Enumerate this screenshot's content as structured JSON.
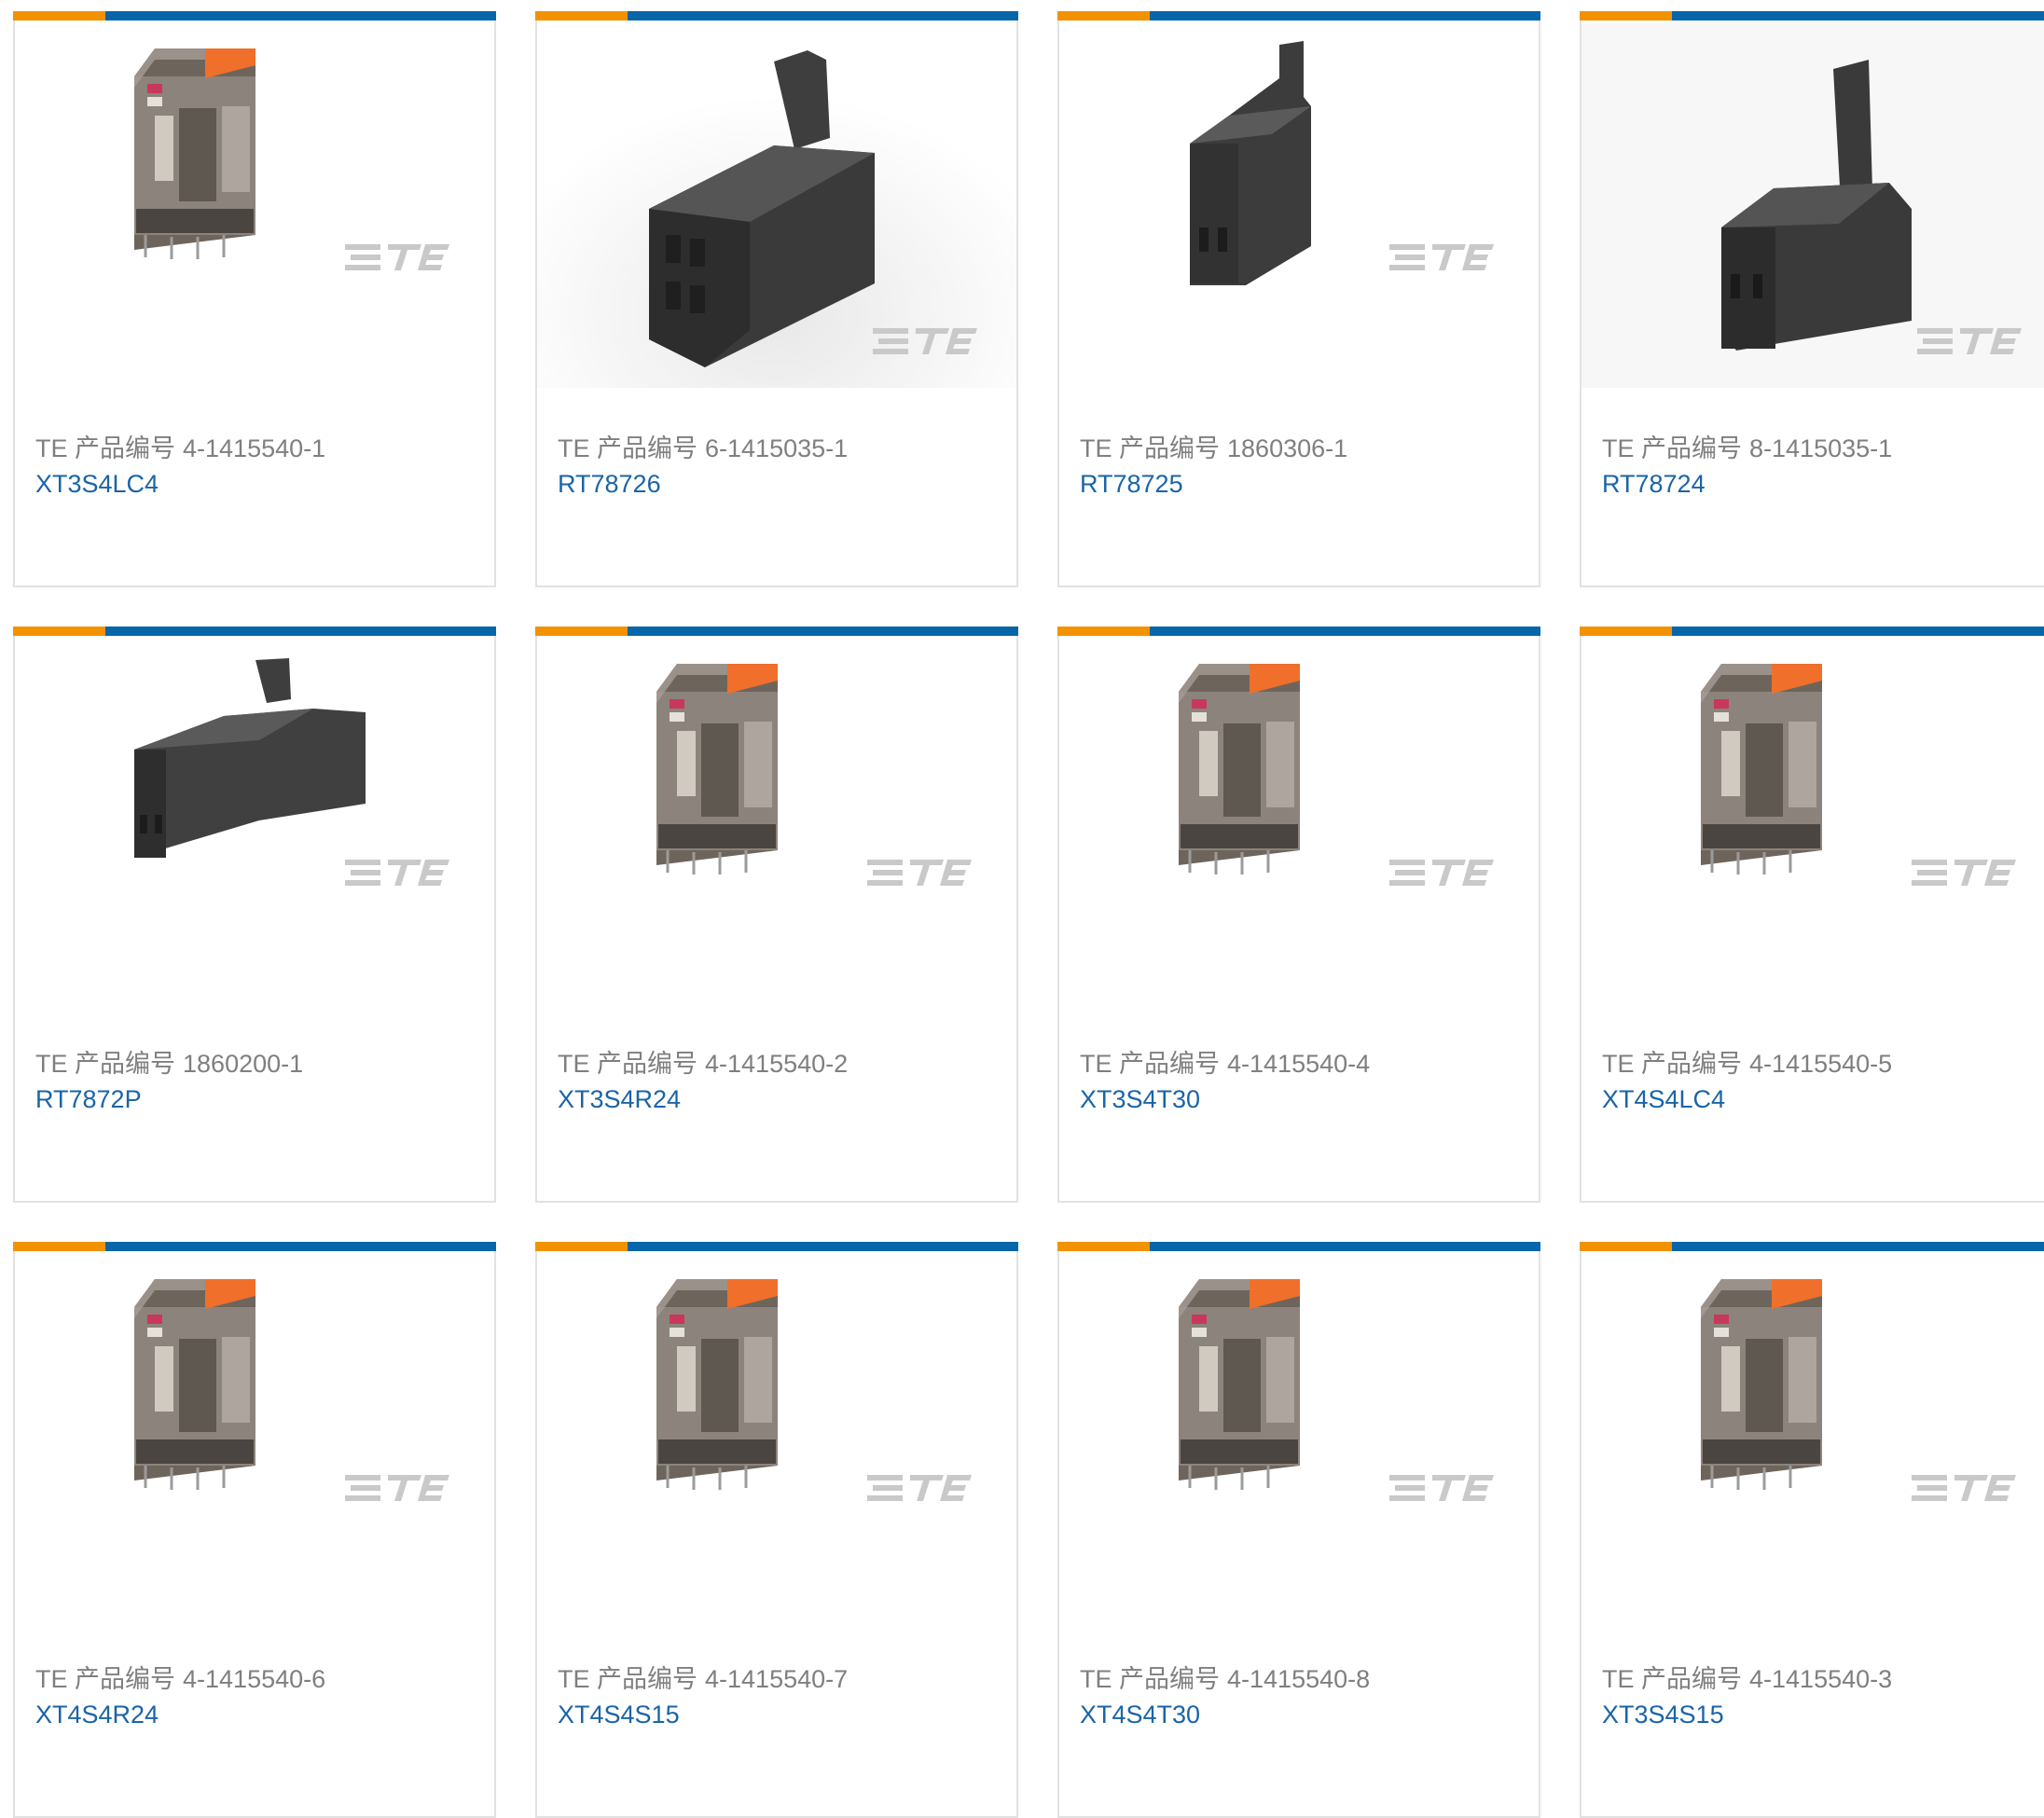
{
  "colors": {
    "accent_orange": "#f39200",
    "accent_blue": "#0765a9",
    "link": "#1a64a8",
    "label": "#7f7f7f"
  },
  "products": [
    {
      "label": "TE 产品编号",
      "part_number": "4-1415540-1",
      "model": "XT3S4LC4",
      "image": "relay-icon"
    },
    {
      "label": "TE 产品编号",
      "part_number": "6-1415035-1",
      "model": "RT78726",
      "image": "socket-icon"
    },
    {
      "label": "TE 产品编号",
      "part_number": "1860306-1",
      "model": "RT78725",
      "image": "socket-icon"
    },
    {
      "label": "TE 产品编号",
      "part_number": "8-1415035-1",
      "model": "RT78724",
      "image": "socket-icon"
    },
    {
      "label": "TE 产品编号",
      "part_number": "1860200-1",
      "model": "RT7872P",
      "image": "socket-icon"
    },
    {
      "label": "TE 产品编号",
      "part_number": "4-1415540-2",
      "model": "XT3S4R24",
      "image": "relay-icon"
    },
    {
      "label": "TE 产品编号",
      "part_number": "4-1415540-4",
      "model": "XT3S4T30",
      "image": "relay-icon"
    },
    {
      "label": "TE 产品编号",
      "part_number": "4-1415540-5",
      "model": "XT4S4LC4",
      "image": "relay-icon"
    },
    {
      "label": "TE 产品编号",
      "part_number": "4-1415540-6",
      "model": "XT4S4R24",
      "image": "relay-icon"
    },
    {
      "label": "TE 产品编号",
      "part_number": "4-1415540-7",
      "model": "XT4S4S15",
      "image": "relay-icon"
    },
    {
      "label": "TE 产品编号",
      "part_number": "4-1415540-8",
      "model": "XT4S4T30",
      "image": "relay-icon"
    },
    {
      "label": "TE 产品编号",
      "part_number": "4-1415540-3",
      "model": "XT3S4S15",
      "image": "relay-icon"
    }
  ]
}
